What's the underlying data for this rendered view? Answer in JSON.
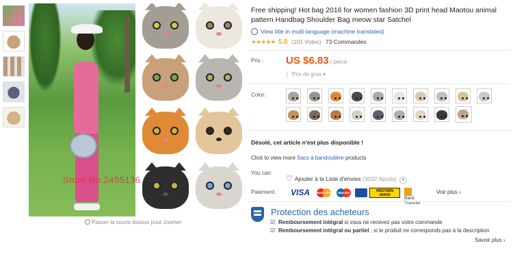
{
  "gallery": {
    "zoom_hint": "Passer la souris dessus pour zoomer",
    "watermark": "Store No.2455136",
    "thumb_colors": [
      "#7aa95a",
      "#caa37b",
      "#b89a7e",
      "#5d5f7a",
      "#d2b38a"
    ]
  },
  "product": {
    "title": "Free shipping! Hot bag 2016 for women fashion 3D print head Maotou animal pattern Handbag Shoulder Bag meow star Satchel",
    "translate_link": "View title in multi-language (machine translated)",
    "rating": {
      "stars": "★★★★★",
      "score": "5.0",
      "votes": "(101 Votes)",
      "orders": "73 Commandes"
    }
  },
  "price": {
    "label": "Prix :",
    "amount": "US $6.83",
    "unit": "/ pièce",
    "wholesale": "Prix de gros ▾"
  },
  "color": {
    "label": "Color:",
    "swatches": [
      {
        "face": "#a8a39b"
      },
      {
        "face": "#9c9389"
      },
      {
        "face": "#d9893e"
      },
      {
        "face": "#4a4a4a"
      },
      {
        "face": "#a9a9a9"
      },
      {
        "face": "#e9e3da"
      },
      {
        "face": "#d8c7b4"
      },
      {
        "face": "#bfbfbf"
      },
      {
        "face": "#d9c29a"
      },
      {
        "face": "#c9c9c9"
      },
      {
        "face": "#c6925a"
      },
      {
        "face": "#7a6a5e"
      },
      {
        "face": "#c07a3f"
      },
      {
        "face": "#d3cdc4"
      },
      {
        "face": "#5a5f68"
      },
      {
        "face": "#b3aea6"
      },
      {
        "face": "#e0d6c8"
      },
      {
        "face": "#3a3a3a"
      },
      {
        "face": "#b8a78d"
      }
    ]
  },
  "availability": {
    "message": "Désolé, cet article n'est plus disponible !",
    "view_more_prefix": "Click to view more ",
    "view_more_link": "Sacs à bandoulière",
    "view_more_suffix": " products"
  },
  "actions": {
    "you_can_label": "You can:",
    "wishlist_label": "Ajouter à la Liste d'envies",
    "wishlist_count": "(3032 Ajouts)",
    "wishlist_dropdown": "▾"
  },
  "payment": {
    "label": "Paiement:",
    "visa": "VISA",
    "mastercard": "MasterCard",
    "maestro": "Maestro",
    "western_union_line1": "WESTERN",
    "western_union_line2": "UNION",
    "bank_line1": "Bank",
    "bank_line2": "Transfer",
    "voir_plus": "Voir plus ›"
  },
  "protection": {
    "title": "Protection des acheteurs",
    "item1_bold": "Remboursement intégral",
    "item1_rest": " si vous ne recevez pas votre commande",
    "item2_bold": "Remboursement intégral ou partiel",
    "item2_rest": " , si le produit ne corresponds pas à la description",
    "savoir_plus": "Savoir plus ›"
  }
}
